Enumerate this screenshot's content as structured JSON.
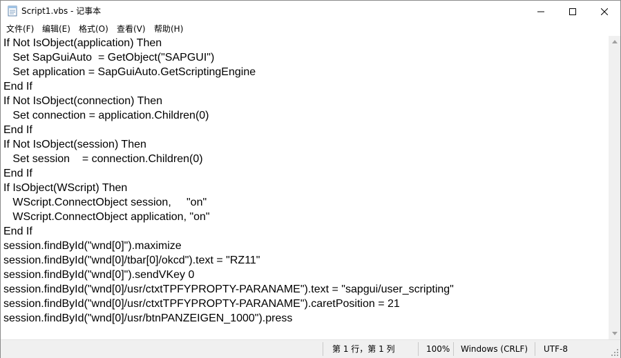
{
  "window": {
    "title": "Script1.vbs - 记事本",
    "controls": {
      "minimize": "—",
      "maximize": "☐",
      "close": "✕"
    }
  },
  "menu": [
    {
      "label": "文件(F)"
    },
    {
      "label": "编辑(E)"
    },
    {
      "label": "格式(O)"
    },
    {
      "label": "查看(V)"
    },
    {
      "label": "帮助(H)"
    }
  ],
  "editor": {
    "lines": [
      "If Not IsObject(application) Then",
      "   Set SapGuiAuto  = GetObject(\"SAPGUI\")",
      "   Set application = SapGuiAuto.GetScriptingEngine",
      "End If",
      "If Not IsObject(connection) Then",
      "   Set connection = application.Children(0)",
      "End If",
      "If Not IsObject(session) Then",
      "   Set session    = connection.Children(0)",
      "End If",
      "If IsObject(WScript) Then",
      "   WScript.ConnectObject session,     \"on\"",
      "   WScript.ConnectObject application, \"on\"",
      "End If",
      "session.findById(\"wnd[0]\").maximize",
      "session.findById(\"wnd[0]/tbar[0]/okcd\").text = \"RZ11\"",
      "session.findById(\"wnd[0]\").sendVKey 0",
      "session.findById(\"wnd[0]/usr/ctxtTPFYPROPTY-PARANAME\").text = \"sapgui/user_scripting\"",
      "session.findById(\"wnd[0]/usr/ctxtTPFYPROPTY-PARANAME\").caretPosition = 21",
      "session.findById(\"wnd[0]/usr/btnPANZEIGEN_1000\").press"
    ]
  },
  "status": {
    "position": "第 1 行，第 1 列",
    "zoom": "100%",
    "line_ending": "Windows (CRLF)",
    "encoding": "UTF-8"
  }
}
